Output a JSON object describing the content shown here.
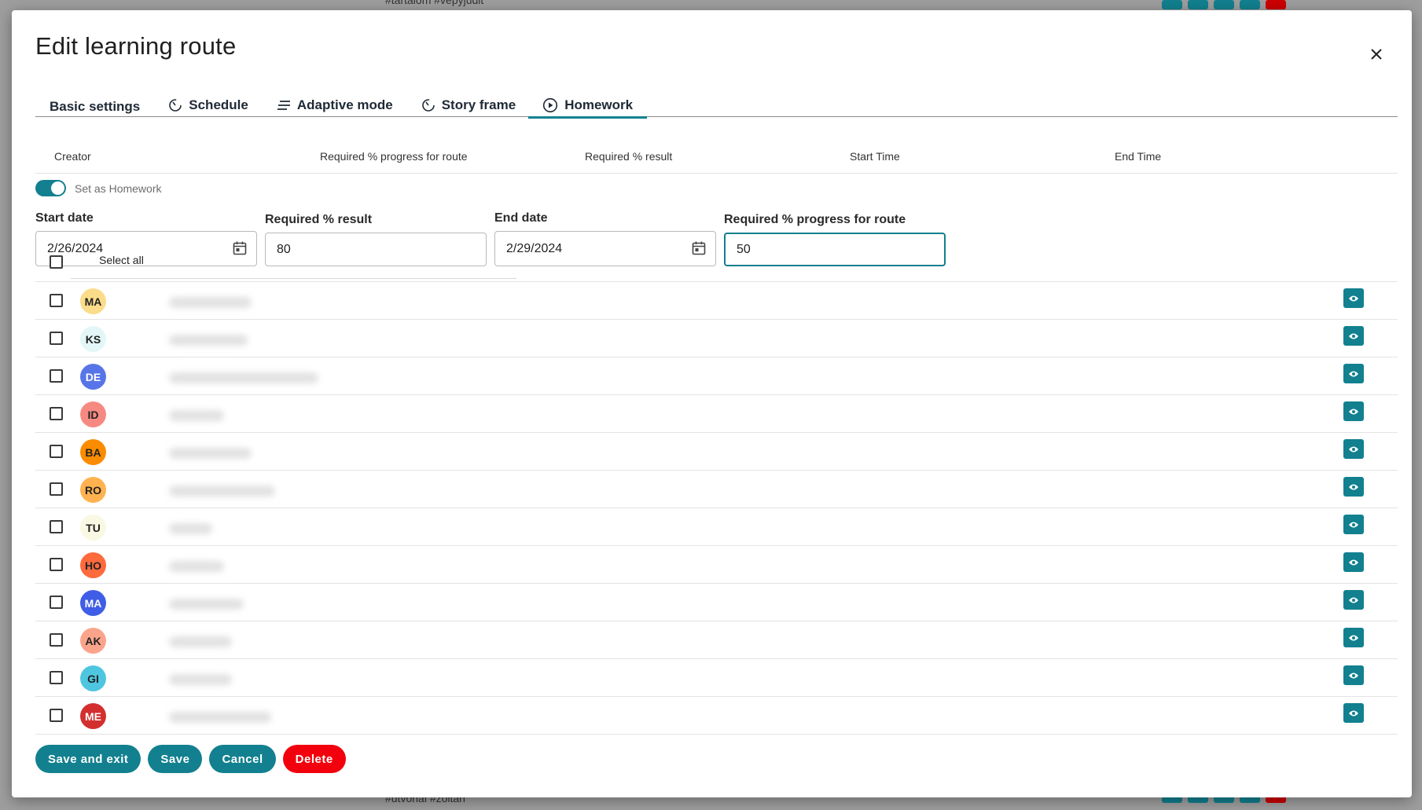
{
  "background": {
    "top_tags": "#tartalom #vepyjudit",
    "bottom_tags": "#utvonal #zoltan"
  },
  "modal": {
    "title": "Edit learning route",
    "close_icon": "close-icon"
  },
  "tabs": [
    {
      "label": "Basic settings",
      "icon": "",
      "active": false
    },
    {
      "label": "Schedule",
      "icon": "timer-icon",
      "active": false
    },
    {
      "label": "Adaptive mode",
      "icon": "lines-icon",
      "active": false
    },
    {
      "label": "Story frame",
      "icon": "timer-icon",
      "active": false
    },
    {
      "label": "Homework",
      "icon": "play-circle-icon",
      "active": true
    }
  ],
  "history_table": {
    "headers": [
      "Creator",
      "Required % progress for route",
      "Required % result",
      "Start Time",
      "End Time"
    ]
  },
  "homework": {
    "toggle_label": "Set as Homework",
    "toggle_on": true,
    "start_date_label": "Start date",
    "start_date_value": "2/26/2024",
    "required_result_label": "Required % result",
    "required_result_value": "80",
    "end_date_label": "End date",
    "end_date_value": "2/29/2024",
    "required_progress_label": "Required % progress for route",
    "required_progress_value": "50"
  },
  "students": {
    "select_all_label": "Select all",
    "rows": [
      {
        "initials": "MA",
        "color": "#fbdc8a",
        "text": "#222",
        "blur_w": 105
      },
      {
        "initials": "KS",
        "color": "#e3f6f8",
        "text": "#222",
        "blur_w": 100
      },
      {
        "initials": "DE",
        "color": "#5875e8",
        "text": "#fff",
        "blur_w": 190
      },
      {
        "initials": "ID",
        "color": "#f68a82",
        "text": "#222",
        "blur_w": 70
      },
      {
        "initials": "BA",
        "color": "#fb8c00",
        "text": "#222",
        "blur_w": 105
      },
      {
        "initials": "RO",
        "color": "#ffb24f",
        "text": "#222",
        "blur_w": 135
      },
      {
        "initials": "TU",
        "color": "#f9f8e2",
        "text": "#222",
        "blur_w": 55
      },
      {
        "initials": "HO",
        "color": "#ff6a3d",
        "text": "#222",
        "blur_w": 70
      },
      {
        "initials": "MA",
        "color": "#3f5de6",
        "text": "#fff",
        "blur_w": 95
      },
      {
        "initials": "AK",
        "color": "#fba48c",
        "text": "#222",
        "blur_w": 80
      },
      {
        "initials": "GI",
        "color": "#4ec6e0",
        "text": "#222",
        "blur_w": 80
      },
      {
        "initials": "ME",
        "color": "#d32f2f",
        "text": "#fff",
        "blur_w": 130
      }
    ]
  },
  "footer": {
    "save_exit_label": "Save and exit",
    "save_label": "Save",
    "cancel_label": "Cancel",
    "delete_label": "Delete"
  },
  "colors": {
    "accent": "#12808f",
    "danger": "#f2000d"
  }
}
